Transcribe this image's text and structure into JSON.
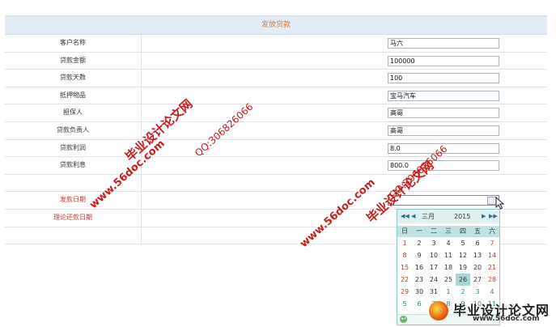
{
  "form": {
    "title": "发放贷款",
    "rows": [
      {
        "label": "客户名称",
        "value": "马六"
      },
      {
        "label": "贷款金额",
        "value": "100000"
      },
      {
        "label": "贷款天数",
        "value": "100"
      },
      {
        "label": "抵押物品",
        "value": "宝马汽车"
      },
      {
        "label": "担保人",
        "value": "高哥"
      },
      {
        "label": "贷款负责人",
        "value": "高哥"
      },
      {
        "label": "贷款利润",
        "value": "8.0"
      },
      {
        "label": "贷款利息",
        "value": "800.0"
      }
    ],
    "issue_date_label": "发款日期",
    "issue_date_value": "",
    "due_date_label": "理论还款日期"
  },
  "calendar": {
    "month": "三月",
    "year": "2015",
    "nav_prev_year": "◀◀",
    "nav_prev_month": "◀",
    "nav_next_month": "▶",
    "nav_next_year": "▶▶",
    "weekdays": [
      "日",
      "一",
      "二",
      "三",
      "四",
      "五",
      "六"
    ],
    "weeks": [
      [
        "1",
        "2",
        "3",
        "4",
        "5",
        "6",
        "7"
      ],
      [
        "8",
        "9",
        "10",
        "11",
        "12",
        "13",
        "14"
      ],
      [
        "15",
        "16",
        "17",
        "18",
        "19",
        "20",
        "21"
      ],
      [
        "22",
        "23",
        "24",
        "25",
        "26",
        "27",
        "28"
      ],
      [
        "29",
        "30",
        "31",
        "1",
        "2",
        "3",
        "4"
      ],
      [
        "5",
        "6",
        "7",
        "8",
        "9",
        "10",
        "11"
      ]
    ],
    "selected_day": "26"
  },
  "watermarks": {
    "url": "www.56doc.com",
    "qq": "QQ:306826066",
    "site": "毕业设计论文网",
    "brand_url": "www.56doc.com"
  },
  "colors": {
    "header_bg": "#e1ecf6",
    "title_text": "#e07b2a",
    "watermark": "#cc1b1b",
    "calendar_accent": "#bfe3e3"
  }
}
